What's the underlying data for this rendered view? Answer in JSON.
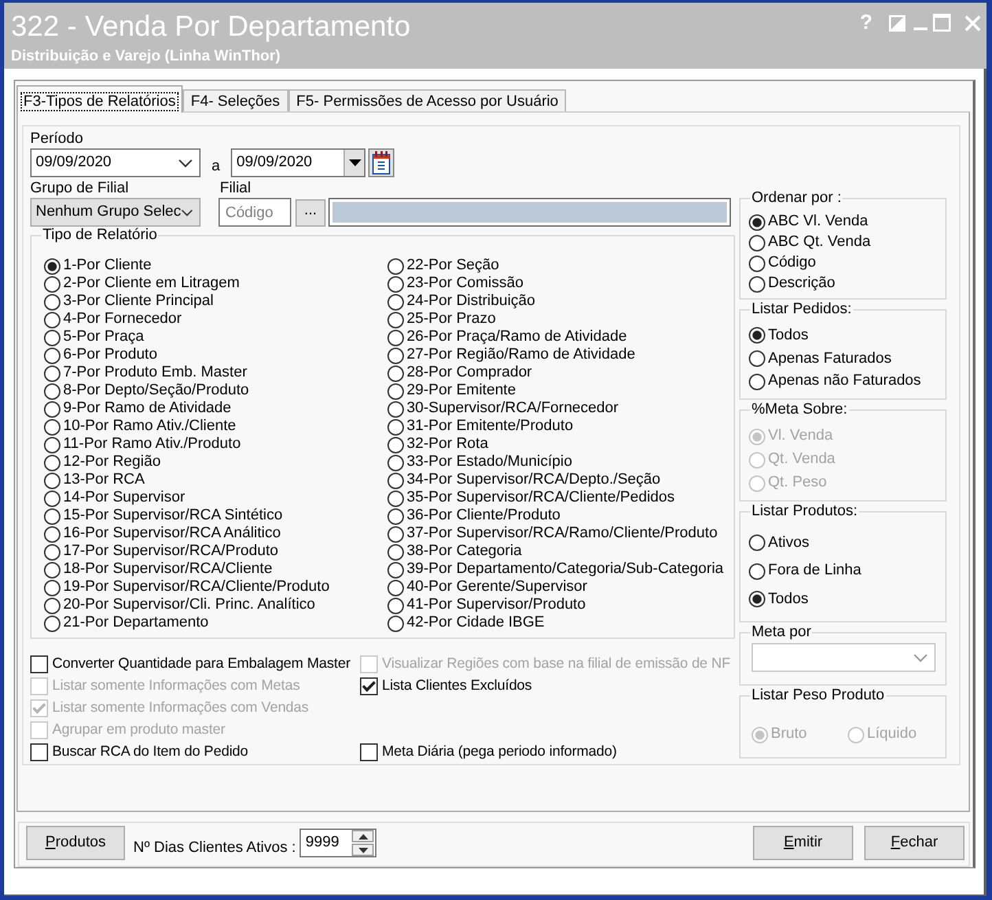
{
  "window": {
    "title": "322 - Venda Por Departamento",
    "subtitle": "Distribuição e Varejo (Linha WinThor)",
    "help_button": "?"
  },
  "tabs": [
    {
      "label": "F3-Tipos de Relatórios",
      "selected": true
    },
    {
      "label": "F4- Seleções",
      "selected": false
    },
    {
      "label": "F5- Permissões de Acesso por Usuário",
      "selected": false
    }
  ],
  "period": {
    "label": "Período",
    "from": "09/09/2020",
    "separator": "a",
    "to": "09/09/2020"
  },
  "branch_group": {
    "label": "Grupo de Filial",
    "value": "Nenhum Grupo Selec"
  },
  "branch": {
    "label": "Filial",
    "placeholder": "Código",
    "lookup_button": "..."
  },
  "report_type": {
    "title": "Tipo de Relatório",
    "options": [
      {
        "label": "1-Por Cliente",
        "selected": true
      },
      {
        "label": "2-Por Cliente em Litragem",
        "selected": false
      },
      {
        "label": "3-Por Cliente Principal",
        "selected": false
      },
      {
        "label": "4-Por Fornecedor",
        "selected": false
      },
      {
        "label": "5-Por Praça",
        "selected": false
      },
      {
        "label": "6-Por Produto",
        "selected": false
      },
      {
        "label": "7-Por Produto Emb. Master",
        "selected": false
      },
      {
        "label": "8-Por Depto/Seção/Produto",
        "selected": false
      },
      {
        "label": "9-Por Ramo de Atividade",
        "selected": false
      },
      {
        "label": "10-Por Ramo Ativ./Cliente",
        "selected": false
      },
      {
        "label": "11-Por Ramo Ativ./Produto",
        "selected": false
      },
      {
        "label": "12-Por Região",
        "selected": false
      },
      {
        "label": "13-Por RCA",
        "selected": false
      },
      {
        "label": "14-Por Supervisor",
        "selected": false
      },
      {
        "label": "15-Por Supervisor/RCA Sintético",
        "selected": false
      },
      {
        "label": "16-Por Supervisor/RCA Análitico",
        "selected": false
      },
      {
        "label": "17-Por Supervisor/RCA/Produto",
        "selected": false
      },
      {
        "label": "18-Por Supervisor/RCA/Cliente",
        "selected": false
      },
      {
        "label": "19-Por Supervisor/RCA/Cliente/Produto",
        "selected": false
      },
      {
        "label": "20-Por Supervisor/Cli. Princ. Analítico",
        "selected": false
      },
      {
        "label": "21-Por Departamento",
        "selected": false
      },
      {
        "label": "22-Por Seção",
        "selected": false
      },
      {
        "label": "23-Por Comissão",
        "selected": false
      },
      {
        "label": "24-Por Distribuição",
        "selected": false
      },
      {
        "label": "25-Por Prazo",
        "selected": false
      },
      {
        "label": "26-Por Praça/Ramo de Atividade",
        "selected": false
      },
      {
        "label": "27-Por Região/Ramo de Atividade",
        "selected": false
      },
      {
        "label": "28-Por Comprador",
        "selected": false
      },
      {
        "label": "29-Por Emitente",
        "selected": false
      },
      {
        "label": "30-Supervisor/RCA/Fornecedor",
        "selected": false
      },
      {
        "label": "31-Por Emitente/Produto",
        "selected": false
      },
      {
        "label": "32-Por Rota",
        "selected": false
      },
      {
        "label": "33-Por Estado/Município",
        "selected": false
      },
      {
        "label": "34-Por Supervisor/RCA/Depto./Seção",
        "selected": false
      },
      {
        "label": "35-Por Supervisor/RCA/Cliente/Pedidos",
        "selected": false
      },
      {
        "label": "36-Por Cliente/Produto",
        "selected": false
      },
      {
        "label": "37-Por Supervisor/RCA/Ramo/Cliente/Produto",
        "selected": false
      },
      {
        "label": "38-Por Categoria",
        "selected": false
      },
      {
        "label": "39-Por Departamento/Categoria/Sub-Categoria",
        "selected": false
      },
      {
        "label": "40-Por Gerente/Supervisor",
        "selected": false
      },
      {
        "label": "41-Por Supervisor/Produto",
        "selected": false
      },
      {
        "label": "42-Por Cidade IBGE",
        "selected": false
      }
    ]
  },
  "checkbox_rows": [
    [
      {
        "label": "Converter Quantidade para Embalagem Master",
        "checked": false,
        "disabled": false
      },
      {
        "label": "Visualizar Regiões com base na filial de emissão de NF",
        "checked": false,
        "disabled": true
      }
    ],
    [
      {
        "label": "Listar somente Informações com Metas",
        "checked": false,
        "disabled": true
      },
      {
        "label": "Lista Clientes Excluídos",
        "checked": true,
        "disabled": false
      }
    ],
    [
      {
        "label": "Listar somente Informações com Vendas",
        "checked": true,
        "disabled": true
      }
    ],
    [
      {
        "label": "Agrupar em produto master",
        "checked": false,
        "disabled": true
      }
    ],
    [
      {
        "label": "Buscar RCA do Item do Pedido",
        "checked": false,
        "disabled": false
      },
      {
        "label": "Meta Diária (pega periodo informado)",
        "checked": false,
        "disabled": false
      }
    ]
  ],
  "right_panels": [
    {
      "kind": "radio",
      "title": "Ordenar por :",
      "options": [
        {
          "label": "ABC Vl. Venda",
          "selected": true,
          "disabled": false
        },
        {
          "label": "ABC Qt. Venda",
          "selected": false,
          "disabled": false
        },
        {
          "label": "Código",
          "selected": false,
          "disabled": false
        },
        {
          "label": "Descrição",
          "selected": false,
          "disabled": false
        }
      ]
    },
    {
      "kind": "radio",
      "title": "Listar Pedidos:",
      "options": [
        {
          "label": "Todos",
          "selected": true,
          "disabled": false
        },
        {
          "label": "Apenas Faturados",
          "selected": false,
          "disabled": false
        },
        {
          "label": "Apenas não Faturados",
          "selected": false,
          "disabled": false
        }
      ]
    },
    {
      "kind": "radio",
      "title": "%Meta Sobre:",
      "options": [
        {
          "label": "Vl. Venda",
          "selected": true,
          "disabled": true
        },
        {
          "label": "Qt. Venda",
          "selected": false,
          "disabled": true
        },
        {
          "label": "Qt. Peso",
          "selected": false,
          "disabled": true
        }
      ]
    },
    {
      "kind": "radio",
      "title": "Listar Produtos:",
      "options": [
        {
          "label": "Ativos",
          "selected": false,
          "disabled": false
        },
        {
          "label": "Fora de Linha",
          "selected": false,
          "disabled": false
        },
        {
          "label": "Todos",
          "selected": true,
          "disabled": false
        }
      ]
    },
    {
      "kind": "select",
      "title": "Meta por"
    },
    {
      "kind": "radio_row",
      "title": "Listar Peso Produto",
      "options": [
        {
          "label": "Bruto",
          "selected": true,
          "disabled": true
        },
        {
          "label": "Líquido",
          "selected": false,
          "disabled": true
        }
      ]
    }
  ],
  "footer": {
    "products_button": "Produtos",
    "days_label": "Nº Dias Clientes Ativos :",
    "days_value": "9999",
    "buttons": [
      "Emitir",
      "Fechar"
    ]
  }
}
